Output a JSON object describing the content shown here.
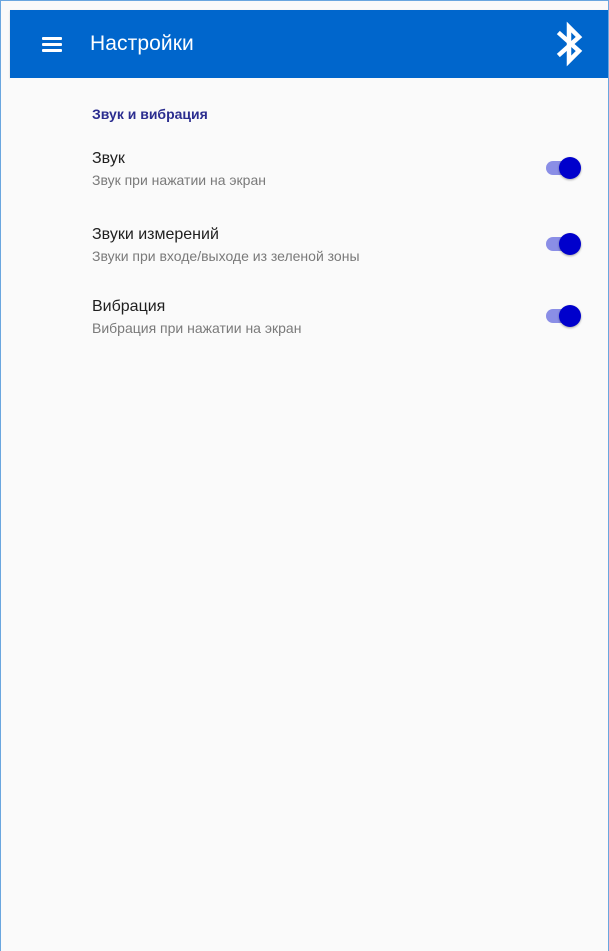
{
  "app_bar": {
    "title": "Настройки",
    "menu_icon": "menu-icon",
    "bluetooth_icon": "bluetooth-icon",
    "background_color": "#0066cc"
  },
  "section": {
    "title": "Звук и вибрация",
    "title_color": "#2b2d8f"
  },
  "settings": [
    {
      "title": "Звук",
      "subtitle": "Звук при нажатии на экран",
      "enabled": true
    },
    {
      "title": "Звуки измерений",
      "subtitle": "Звуки при входе/выходе из зеленой зоны",
      "enabled": true
    },
    {
      "title": "Вибрация",
      "subtitle": "Вибрация при нажатии на экран",
      "enabled": true
    }
  ],
  "switch_colors": {
    "thumb": "#0000cc",
    "track": "#8a8ee6"
  }
}
